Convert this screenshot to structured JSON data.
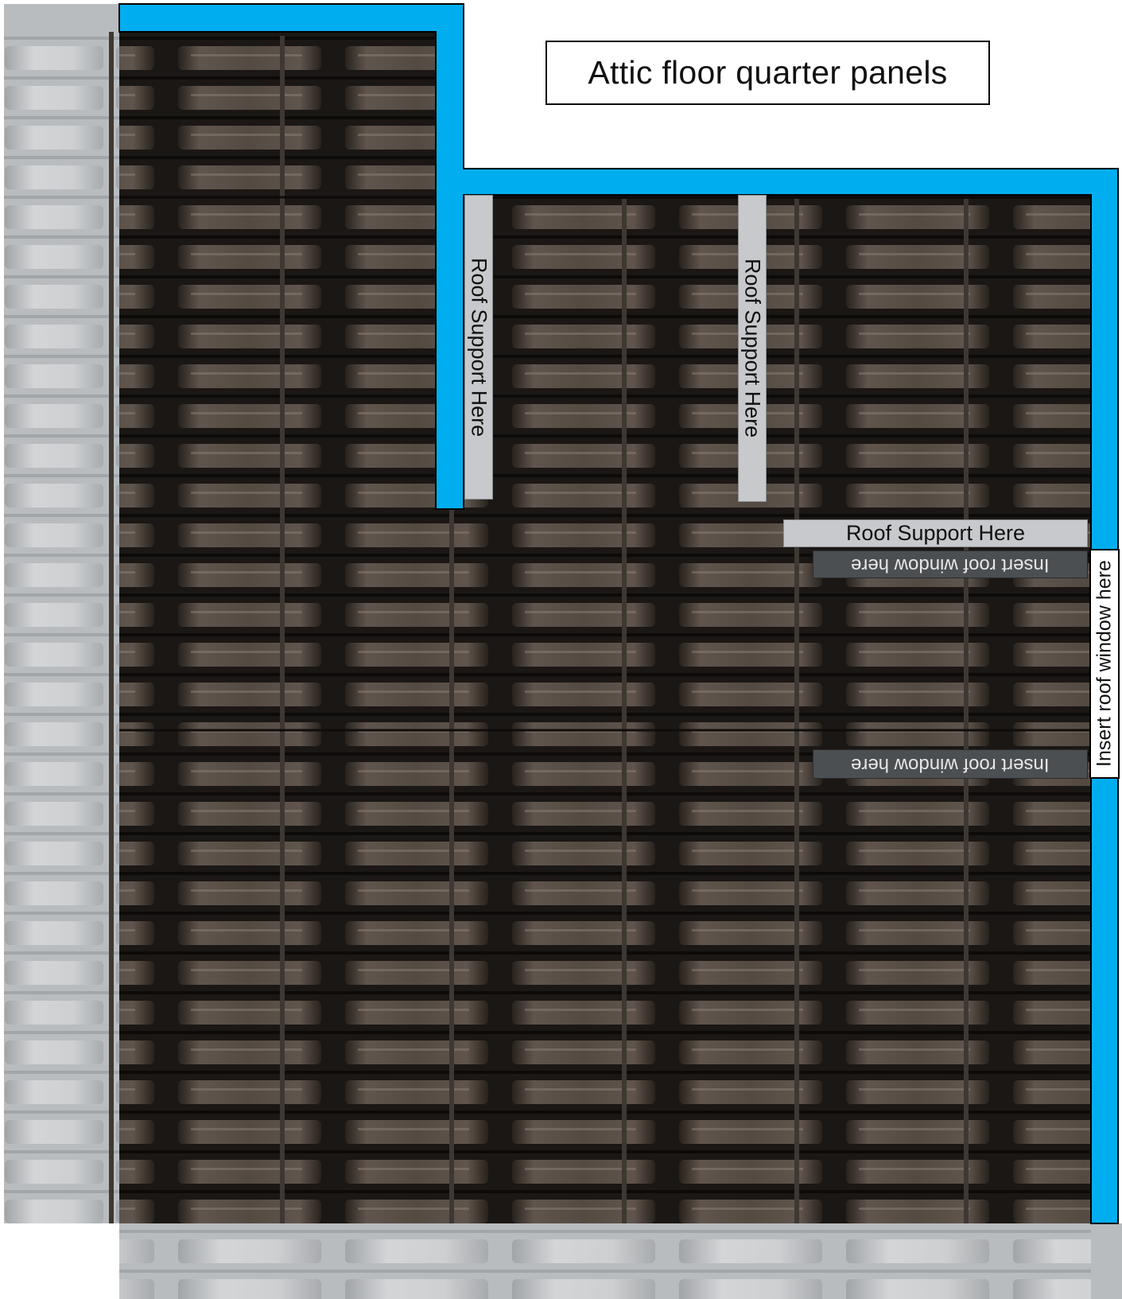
{
  "title": "Attic floor quarter panels",
  "labels": {
    "roof_support": "Roof Support Here",
    "insert_window": "Insert roof window here"
  },
  "colors": {
    "wall_outline": "#00aeef",
    "floor_dark": "#1b1714",
    "plank_light": "#6b6057",
    "ghost_panel": "#b9bcbf",
    "label_light": "#c7c9cc",
    "label_dark": "#4c4f52"
  }
}
